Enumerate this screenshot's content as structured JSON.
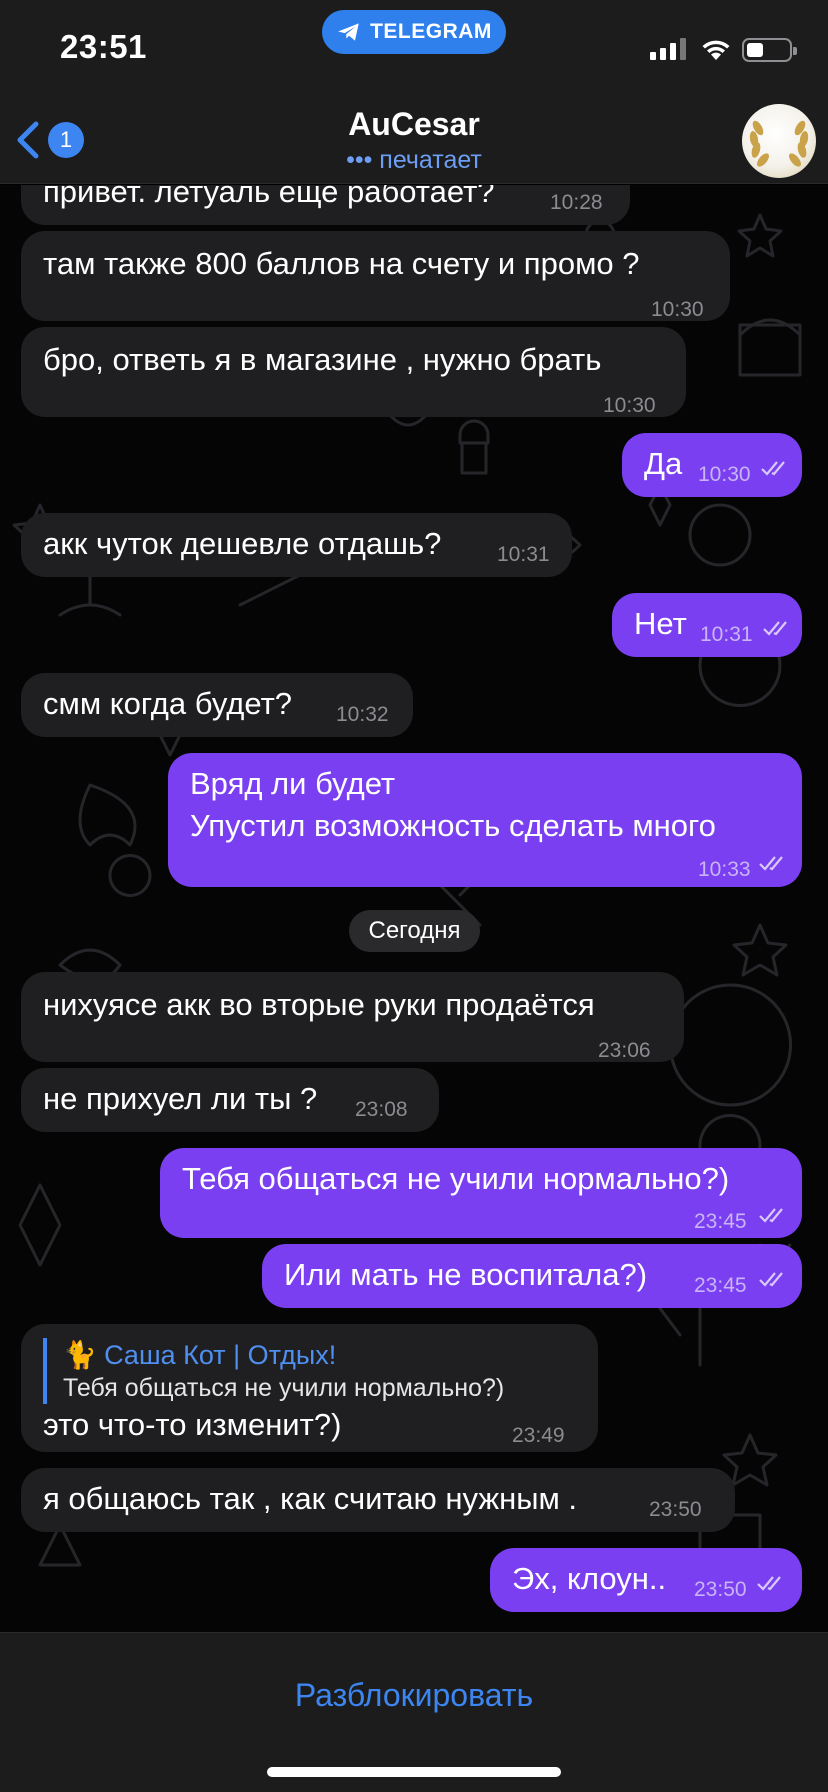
{
  "status_bar": {
    "time": "23:51",
    "app_pill": "TELEGRAM"
  },
  "header": {
    "back_badge": "1",
    "title": "AuCesar",
    "subtitle": "••• печатает"
  },
  "messages": [
    {
      "dir": "in",
      "text": "привет. летуаль еще работает?",
      "time": "10:28"
    },
    {
      "dir": "in",
      "text": "там также 800 баллов на счету и промо ?",
      "time": "10:30"
    },
    {
      "dir": "in",
      "text": "бро, ответь я в магазине , нужно брать",
      "time": "10:30"
    },
    {
      "dir": "out",
      "text": "Да",
      "time": "10:30"
    },
    {
      "dir": "in",
      "text": "акк чуток дешевле отдашь?",
      "time": "10:31"
    },
    {
      "dir": "out",
      "text": "Нет",
      "time": "10:31"
    },
    {
      "dir": "in",
      "text": "смм когда будет?",
      "time": "10:32"
    },
    {
      "dir": "out",
      "line1": "Вряд ли будет",
      "line2": "Упустил возможность сделать много",
      "time": "10:33"
    },
    {
      "dir": "in",
      "text": "нихуясе акк во вторые руки продаётся",
      "time": "23:06"
    },
    {
      "dir": "in",
      "text": "не прихуел ли ты ?",
      "time": "23:08"
    },
    {
      "dir": "out",
      "text": "Тебя общаться не учили нормально?)",
      "time": "23:45"
    },
    {
      "dir": "out",
      "text": "Или мать не воспитала?)",
      "time": "23:45"
    },
    {
      "dir": "in",
      "reply_name": "🐈 Саша Кот | Отдых!",
      "reply_text": "Тебя общаться не учили нормально?)",
      "text": "это что-то изменит?)",
      "time": "23:49"
    },
    {
      "dir": "in",
      "text": "я общаюсь так , как считаю нужным .",
      "time": "23:50"
    },
    {
      "dir": "out",
      "text": "Эх, клоун..",
      "time": "23:50"
    }
  ],
  "date_separator": "Сегодня",
  "bottom": {
    "unblock_label": "Разблокировать"
  },
  "colors": {
    "outgoing_bubble": "#7a3ff0",
    "incoming_bubble": "#1f1f21",
    "accent": "#3d86f1"
  }
}
